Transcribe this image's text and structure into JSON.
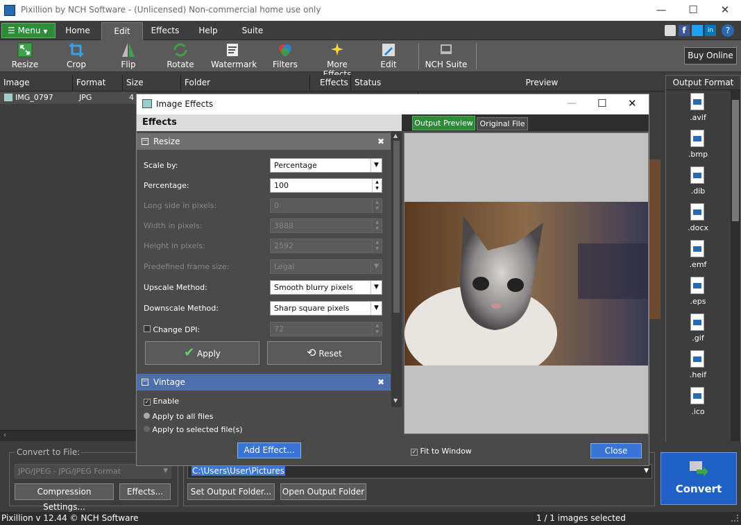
{
  "window": {
    "title": "Pixillion by NCH Software - (Unlicensed) Non-commercial home use only"
  },
  "menu": {
    "label": "Menu",
    "tabs": [
      "Home",
      "Edit",
      "Effects",
      "Help",
      "Suite"
    ],
    "active_tab": "Edit"
  },
  "toolbar": {
    "items": [
      "Resize",
      "Crop",
      "Flip",
      "Rotate",
      "Watermark",
      "Filters",
      "More Effects",
      "Edit",
      "NCH Suite"
    ],
    "buy_online": "Buy Online"
  },
  "file_list": {
    "columns": [
      "Image",
      "Format",
      "Size",
      "Folder",
      "Effects",
      "Status"
    ],
    "rows": [
      {
        "image": "IMG_0797",
        "format": "JPG",
        "size": "4"
      }
    ]
  },
  "preview_header": "Preview",
  "output_format": {
    "header": "Output Format",
    "formats": [
      ".avif",
      ".bmp",
      ".dib",
      ".docx",
      ".emf",
      ".eps",
      ".gif",
      ".heif",
      ".ico"
    ]
  },
  "dialog": {
    "title": "Image Effects",
    "effects_header": "Effects",
    "resize": {
      "title": "Resize",
      "scale_by_label": "Scale by:",
      "scale_by_value": "Percentage",
      "percentage_label": "Percentage:",
      "percentage_value": "100",
      "long_side_label": "Long side in pixels:",
      "long_side_value": "0",
      "width_label": "Width in pixels:",
      "width_value": "3888",
      "height_label": "Height in pixels:",
      "height_value": "2592",
      "frame_label": "Predefined frame size:",
      "frame_value": "Legal",
      "upscale_label": "Upscale Method:",
      "upscale_value": "Smooth blurry pixels",
      "downscale_label": "Downscale Method:",
      "downscale_value": "Sharp square pixels",
      "dpi_label": "Change DPI:",
      "dpi_value": "72",
      "apply": "Apply",
      "reset": "Reset"
    },
    "vintage": {
      "title": "Vintage",
      "enable": "Enable",
      "apply_all": "Apply to all files",
      "apply_selected": "Apply to selected file(s)"
    },
    "tabs": {
      "output_preview": "Output Preview",
      "original_file": "Original File"
    },
    "fit_to_window": "Fit to Window",
    "add_effect": "Add Effect...",
    "close": "Close"
  },
  "bottom": {
    "convert_to_file": "Convert to File:",
    "format_value": "JPG/JPEG - JPG/JPEG Format",
    "compression_settings": "Compression Settings...",
    "effects": "Effects...",
    "output_path": "C:\\Users\\User\\Pictures",
    "set_output_folder": "Set Output Folder...",
    "open_output_folder": "Open Output Folder",
    "convert": "Convert"
  },
  "status": {
    "version": "Pixillion v 12.44 © NCH Software",
    "selected": "1 / 1 images selected"
  }
}
